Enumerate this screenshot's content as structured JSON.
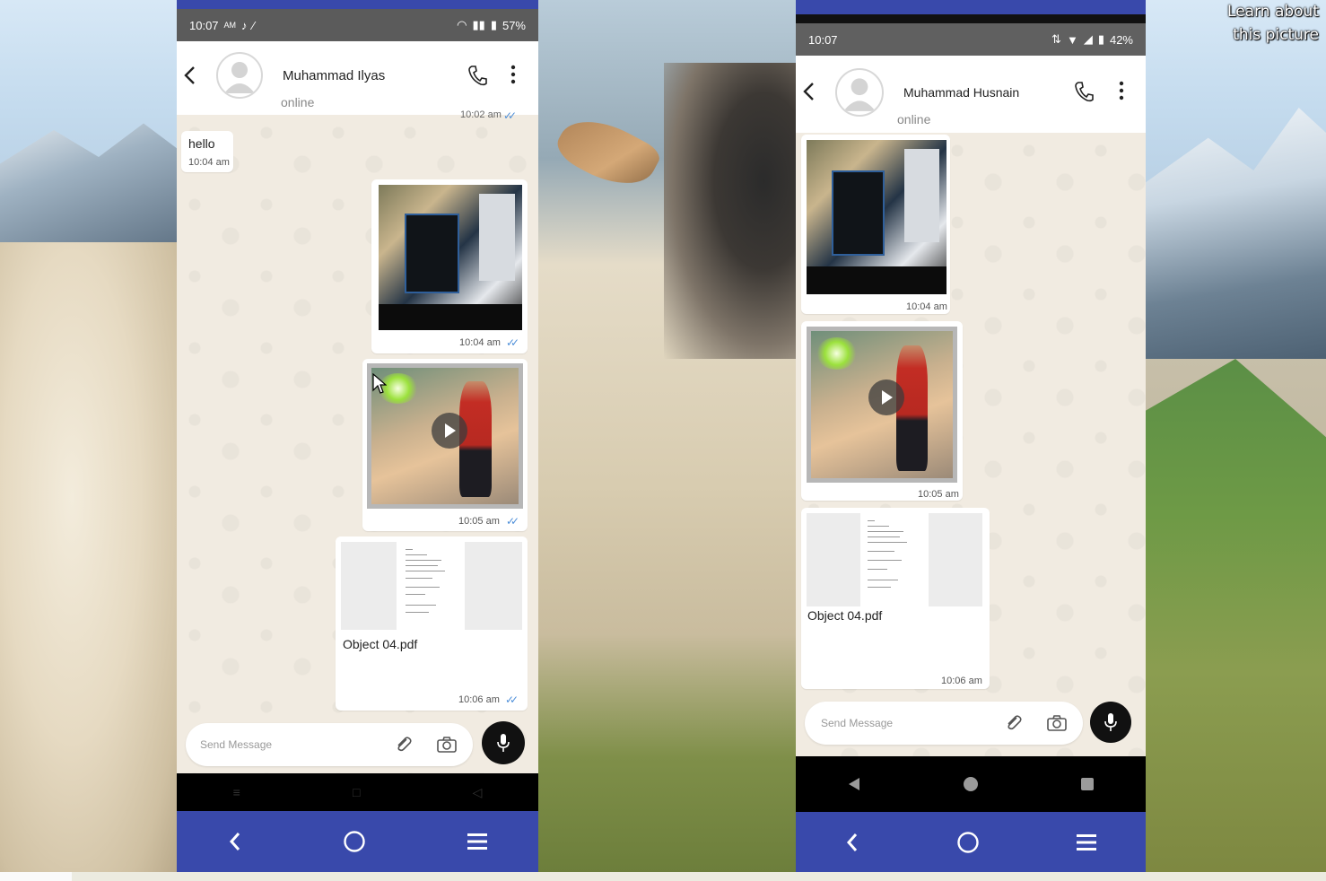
{
  "desktop": {
    "learn_about_line1": "Learn about",
    "learn_about_line2": "this picture"
  },
  "phone_left": {
    "status_time": "10:07",
    "status_ampm": "AM",
    "battery": "57%",
    "contact_name": "Muhammad Ilyas",
    "contact_status": "online",
    "clipped_time": "10:02 am",
    "messages": {
      "hello_text": "hello",
      "hello_time": "10:04 am",
      "image_time": "10:04 am",
      "video_time": "10:05 am",
      "pdf_name": "Object 04.pdf",
      "pdf_time": "10:06 am"
    },
    "input_placeholder": "Send Message"
  },
  "phone_right": {
    "status_time": "10:07",
    "battery": "42%",
    "contact_name": "Muhammad Husnain",
    "contact_status": "online",
    "messages": {
      "image_time": "10:04 am",
      "video_time": "10:05 am",
      "pdf_name": "Object 04.pdf",
      "pdf_time": "10:06 am"
    },
    "input_placeholder": "Send Message"
  },
  "colors": {
    "accent_blue": "#3949ab",
    "read_tick": "#4e8fd9",
    "chat_bg": "#f1ebe1"
  }
}
